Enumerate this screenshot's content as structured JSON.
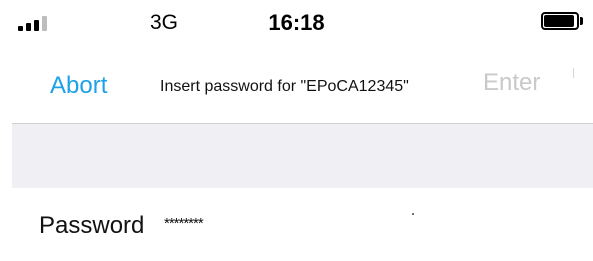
{
  "status_bar": {
    "network": "3G",
    "time": "16:18",
    "signal_bars_filled": 3,
    "signal_bars_total": 4,
    "battery_level": 1.0
  },
  "nav": {
    "left_button": "Abort",
    "title": "Insert password for \"EPoCA12345\"",
    "right_button": "Enter"
  },
  "form": {
    "password_label": "Password",
    "password_value": "********"
  },
  "colors": {
    "accent": "#1da1e8",
    "disabled": "#c9c9c9",
    "group_background": "#efeff4"
  }
}
